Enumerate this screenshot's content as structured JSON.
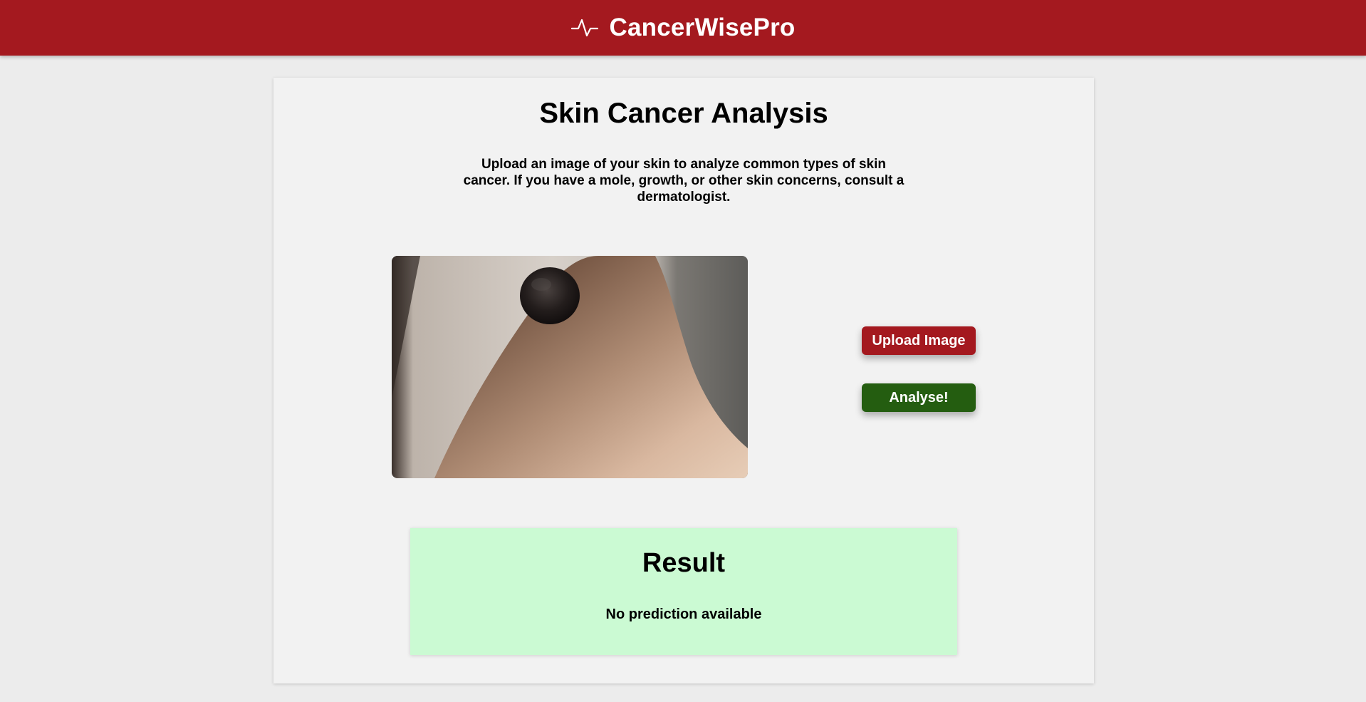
{
  "header": {
    "brand_name": "CancerWisePro",
    "icon": "pulse-icon",
    "background_color": "#a4191f"
  },
  "main": {
    "title": "Skin Cancer Analysis",
    "description": "Upload an image of your skin to analyze common types of skin cancer. If you have a mole, growth, or other skin concerns, consult a dermatologist.",
    "preview_image": "skin-lesion-photo",
    "buttons": {
      "upload_label": "Upload Image",
      "upload_color": "#a4191f",
      "analyse_label": "Analyse!",
      "analyse_color": "#245d10"
    }
  },
  "result": {
    "title": "Result",
    "text": "No prediction available",
    "background_color": "#cbfad3"
  }
}
